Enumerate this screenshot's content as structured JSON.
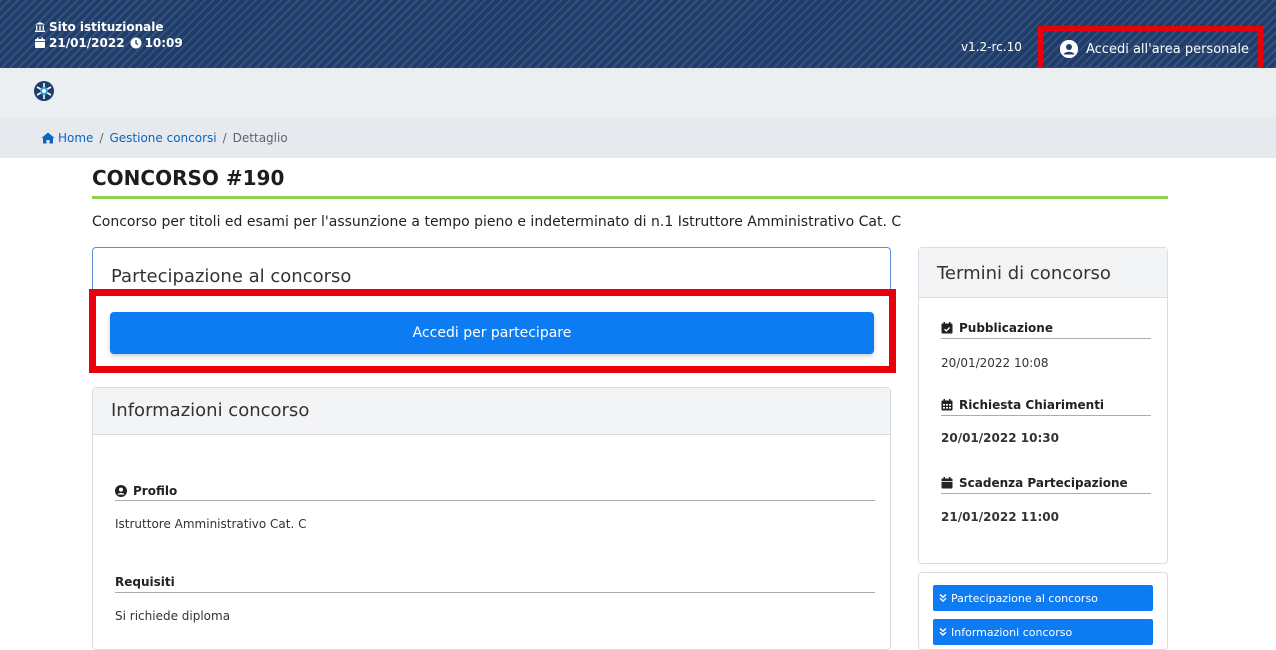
{
  "topbar": {
    "site_label": "Sito istituzionale",
    "date": "21/01/2022",
    "time": "10:09",
    "version": "v1.2-rc.10",
    "login_label": "Accedi all'area personale"
  },
  "breadcrumb": {
    "home": "Home",
    "section": "Gestione concorsi",
    "current": "Dettaglio",
    "separator": "/"
  },
  "page": {
    "title": "CONCORSO #190",
    "subtitle": "Concorso per titoli ed esami per l'assunzione a tempo pieno e indeterminato di n.1 Istruttore Amministrativo Cat. C"
  },
  "participation": {
    "header": "Partecipazione al concorso",
    "button_label": "Accedi per partecipare"
  },
  "info": {
    "header": "Informazioni concorso",
    "profile_label": "Profilo",
    "profile_value": "Istruttore Amministrativo Cat. C",
    "requirements_label": "Requisiti",
    "requirements_value": "Si richiede diploma"
  },
  "terms": {
    "header": "Termini di concorso",
    "items": [
      {
        "label": "Pubblicazione",
        "value": "20/01/2022 10:08",
        "icon": "calendar-check-icon"
      },
      {
        "label": "Richiesta Chiarimenti",
        "value": "20/01/2022 10:30",
        "icon": "calendar-grid-icon"
      },
      {
        "label": "Scadenza Partecipazione",
        "value": "21/01/2022 11:00",
        "icon": "calendar-icon"
      }
    ]
  },
  "quicknav": {
    "items": [
      {
        "label": "Partecipazione al concorso"
      },
      {
        "label": "Informazioni concorso"
      }
    ]
  },
  "colors": {
    "topbar": "#1f3d6b",
    "primary": "#0d7cf2",
    "accent_line": "#8fd14f",
    "highlight": "#e8000a"
  }
}
